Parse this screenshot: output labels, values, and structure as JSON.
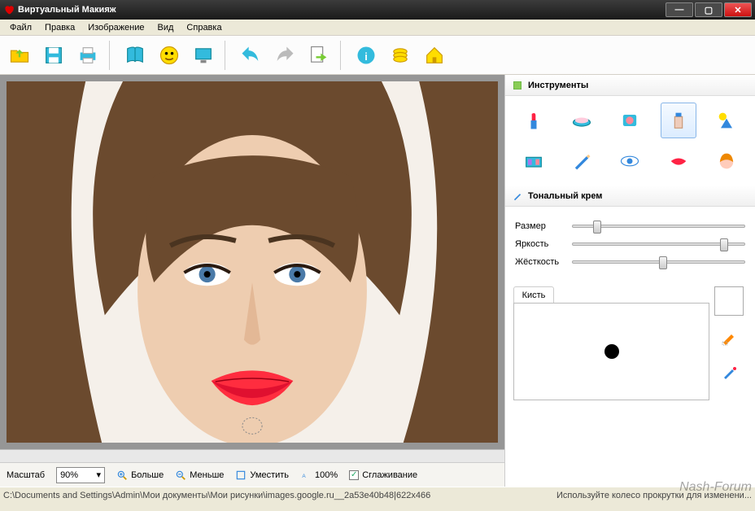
{
  "window": {
    "title": "Виртуальный Макияж"
  },
  "menu": [
    "Файл",
    "Правка",
    "Изображение",
    "Вид",
    "Справка"
  ],
  "toolbar": [
    {
      "name": "open-icon"
    },
    {
      "name": "save-icon"
    },
    {
      "name": "print-icon"
    },
    {
      "sep": true
    },
    {
      "name": "book-icon"
    },
    {
      "name": "smiley-icon"
    },
    {
      "name": "screen-icon"
    },
    {
      "sep": true
    },
    {
      "name": "undo-icon"
    },
    {
      "name": "redo-icon"
    },
    {
      "name": "export-icon"
    },
    {
      "sep": true
    },
    {
      "name": "info-icon"
    },
    {
      "name": "coins-icon"
    },
    {
      "name": "home-icon"
    }
  ],
  "panels": {
    "tools_title": "Инструменты",
    "tool_items": [
      {
        "name": "lipstick-icon"
      },
      {
        "name": "powder-icon"
      },
      {
        "name": "blush-icon"
      },
      {
        "name": "foundation-icon",
        "sel": true
      },
      {
        "name": "tan-icon"
      },
      {
        "name": "eyeshadow-icon"
      },
      {
        "name": "pencil-icon"
      },
      {
        "name": "eye-icon"
      },
      {
        "name": "lips-icon"
      },
      {
        "name": "hair-icon"
      }
    ],
    "current_tool_title": "Тональный крем"
  },
  "sliders": {
    "size": {
      "label": "Размер",
      "value": 12
    },
    "brightness": {
      "label": "Яркость",
      "value": 86
    },
    "hardness": {
      "label": "Жёсткость",
      "value": 50
    }
  },
  "brush": {
    "tab": "Кисть"
  },
  "zoom": {
    "label": "Масштаб",
    "value": "90%",
    "more": "Больше",
    "less": "Меньше",
    "fit": "Уместить",
    "p100": "100%",
    "smooth": "Сглаживание",
    "smooth_checked": true
  },
  "status": {
    "path": "C:\\Documents and Settings\\Admin\\Мои документы\\Мои рисунки\\images.google.ru__2a53e40b48|622x466",
    "hint": "Используйте колесо прокрутки для изменени..."
  },
  "watermark": "Nash-Forum"
}
